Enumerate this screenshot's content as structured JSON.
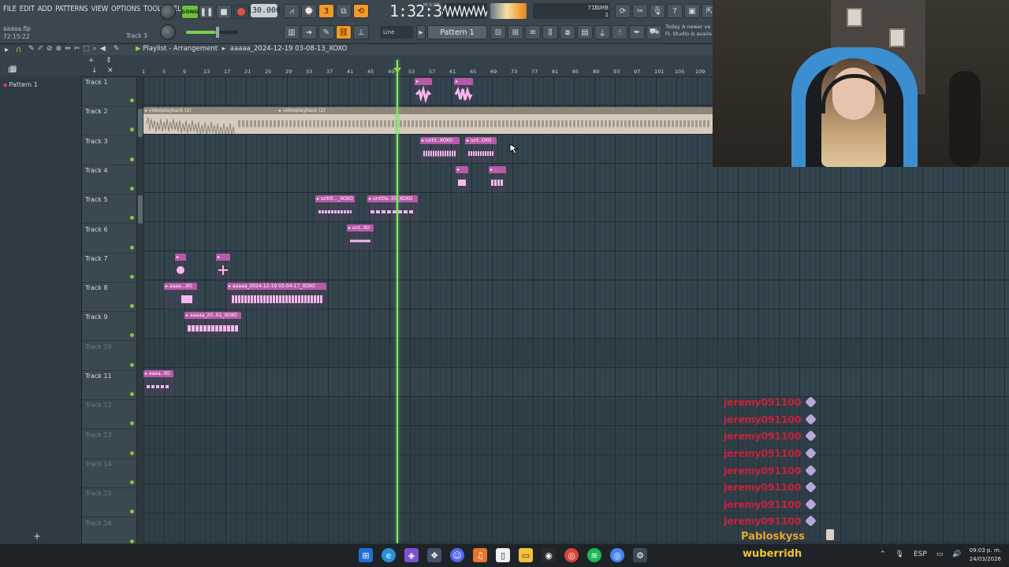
{
  "menu": [
    "FILE",
    "EDIT",
    "ADD",
    "PATTERNS",
    "VIEW",
    "OPTIONS",
    "TOOLS",
    "HELP"
  ],
  "project": {
    "file": "aaaaa.flp",
    "elapsed": "72:15:22",
    "hint_track": "Track 3"
  },
  "transport": {
    "mode": "SONG",
    "tempo": "130.000",
    "time": "1:32:34",
    "time_unit": "M:S:CS"
  },
  "cpu": {
    "value": "11",
    "memory": "715 MB",
    "polyphony": "2"
  },
  "snap": {
    "label": "Line"
  },
  "pattern_selector": {
    "label": "Pattern 1"
  },
  "news": {
    "line1": "Today  A newer ve",
    "line2": "FL Studio is availa"
  },
  "browser": {
    "pattern_item": "Pattern 1"
  },
  "playlist": {
    "title": "Playlist - Arrangement",
    "arrangement": "aaaaa_2024-12-19 03-08-13_XOXO"
  },
  "ruler": [
    "1",
    "5",
    "9",
    "13",
    "17",
    "21",
    "25",
    "29",
    "33",
    "37",
    "41",
    "45",
    "49",
    "53",
    "57",
    "61",
    "65",
    "69",
    "73",
    "77",
    "81",
    "85",
    "89",
    "93",
    "97",
    "101",
    "105",
    "109"
  ],
  "tracks": [
    "Track 1",
    "Track 2",
    "Track 3",
    "Track 4",
    "Track 5",
    "Track 6",
    "Track 7",
    "Track 8",
    "Track 9",
    "Track 10",
    "Track 11",
    "Track 12",
    "Track 13",
    "Track 14",
    "Track 15",
    "Track 16"
  ],
  "clips": {
    "t2a": "videoplayback (2)",
    "t2b": "videoplayback (2)",
    "t3a": "untit..XOXO",
    "t3b": "unt..OXO",
    "t5a": "untitl..._XOXO",
    "t5b": "untitle..55_XOXO",
    "t6a": "unt..XO",
    "t8a": "aaaa...XO",
    "t8b": "aaaaa_2024-12-19 03-04-17_XOXO",
    "t9a": "aaaaa_20..01_XOXO",
    "t11a": "aaaa..XO"
  },
  "chat": {
    "repeated_user": "jeremy091100",
    "repeat_count": 8,
    "last_user": "Pabloskyss"
  },
  "overlay_watermark": "wuberridh",
  "tray": {
    "lang": "ESP",
    "time": "09:03 p. m.",
    "date": "24/03/2026"
  }
}
